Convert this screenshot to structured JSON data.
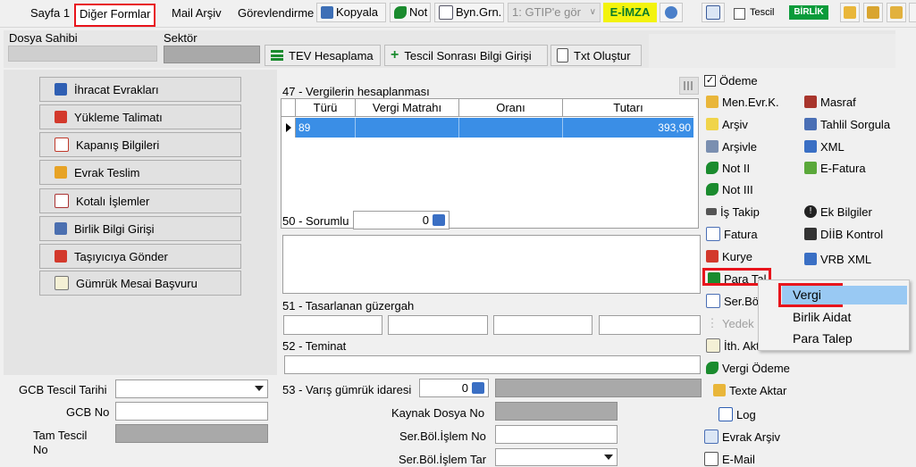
{
  "tabs": [
    {
      "label": "Sayfa 1"
    },
    {
      "label": "Diğer Formlar"
    },
    {
      "label": "Mail Arşiv"
    },
    {
      "label": "Görevlendirme"
    }
  ],
  "toolbar": {
    "copy_label": "Kopyala",
    "note_label": "Not",
    "byn_label": "Byn.Grn.",
    "gtip_value": "1: GTIP'e gör",
    "eimza_label": "E-İMZA",
    "tescil_label": "Tescil",
    "birlik_label": "BİRLİK"
  },
  "header": {
    "dosya_sahibi_label": "Dosya Sahibi",
    "sektor_label": "Sektör",
    "tev_button": "TEV Hesaplama",
    "tescil_sonrasi_button": "Tescil Sonrası Bilgi Girişi",
    "txt_button": "Txt Oluştur"
  },
  "left_buttons": [
    {
      "label": "İhracat Evrakları"
    },
    {
      "label": "Yükleme Talimatı"
    },
    {
      "label": "Kapanış Bilgileri"
    },
    {
      "label": "Evrak Teslim"
    },
    {
      "label": "Kotalı İşlemler"
    },
    {
      "label": "Birlik Bilgi Girişi"
    },
    {
      "label": "Taşıyıcıya Gönder"
    },
    {
      "label": "Gümrük Mesai Başvuru"
    }
  ],
  "bottom_left": {
    "gcb_tescil_tarihi": "GCB Tescil Tarihi",
    "gcb_no": "GCB No",
    "tam_tescil_no": "Tam Tescil No"
  },
  "taxes": {
    "section_label": "47 - Vergilerin hesaplanması",
    "columns": [
      "Türü",
      "Vergi Matrahı",
      "Oranı",
      "Tutarı"
    ],
    "rows": [
      {
        "turu": "89",
        "matrah": "",
        "orani": "",
        "tutari": "393,90"
      }
    ]
  },
  "form": {
    "sorumlu_label": "50 - Sorumlu",
    "sorumlu_value": "0",
    "guzergah_label": "51 - Tasarlanan güzergah",
    "teminat_label": "52 - Teminat",
    "varis_label": "53 - Varış gümrük idaresi",
    "varis_value": "0",
    "kaynak_dosya_label": "Kaynak Dosya No",
    "ser_bol_islem_no_label": "Ser.Böl.İşlem No",
    "ser_bol_islem_tar_label": "Ser.Böl.İşlem Tar"
  },
  "right_menu": {
    "odeme": "Ödeme",
    "men_evr": "Men.Evr.K.",
    "masraf": "Masraf",
    "arsiv": "Arşiv",
    "tahlil": "Tahlil Sorgula",
    "arsivle": "Arşivle",
    "xml": "XML",
    "not_ii": "Not II",
    "efatura": "E-Fatura",
    "not_iii": "Not III",
    "is_takip": "İş Takip",
    "ek_bilgiler": "Ek Bilgiler",
    "fatura": "Fatura",
    "diib": "DİİB Kontrol",
    "kurye": "Kurye",
    "vrb_xml": "VRB XML",
    "para_tal_at": "Para Tal.At.",
    "ser_bo": "Ser.Bö",
    "yedek": "Yedek",
    "ith_akt": "İth. Akt",
    "vergi_odeme": "Vergi Ödeme",
    "texte_aktar": "Texte Aktar",
    "log": "Log",
    "evrak_arsiv": "Evrak Arşiv",
    "email": "E-Mail"
  },
  "context_menu": {
    "items": [
      "Vergi",
      "Birlik Aidat",
      "Para Talep"
    ]
  }
}
